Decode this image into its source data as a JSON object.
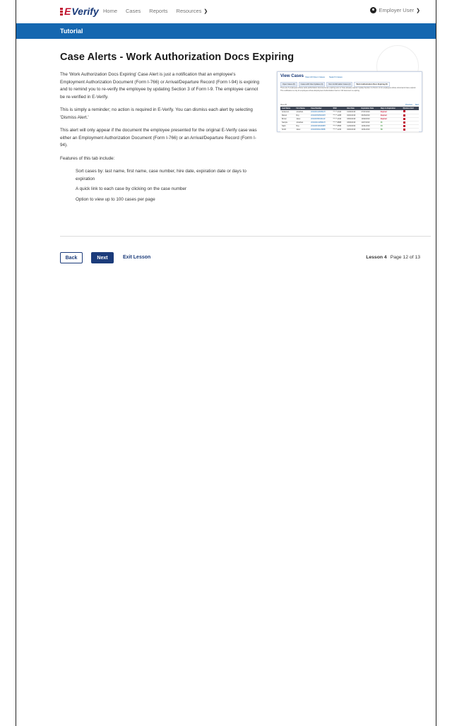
{
  "logo": {
    "text": "Verify",
    "prefix": "E"
  },
  "nav": {
    "items": [
      "Home",
      "Cases",
      "Reports",
      "Resources"
    ],
    "user": "Employer User"
  },
  "banner": {
    "title": "Tutorial"
  },
  "page": {
    "heading": "Case Alerts - Work Authorization Docs Expiring",
    "paragraphs": [
      "The 'Work Authorization Docs Expiring' Case Alert is just a notification that an employee's Employment Authorization Document (Form I-766) or Arrival/Departure Record (Form I-94) is expiring and to remind you to re-verify the employee by updating Section 3 of Form I-9. The employee cannot be re-verified in E-Verify.",
      "This is simply a reminder; no action is required in E-Verify. You can dismiss each alert by selecting 'Dismiss Alert.'",
      "This alert will only appear if the document the employee presented for the original E-Verify case was either an Employment Authorization Document (Form I-766) or an Arrival/Departure Record (Form I-94).",
      "Features of this tab include:"
    ],
    "features": [
      "Sort cases by: last name, first name, case number, hire date, expiration date or days to expiration",
      "A quick link to each case by clicking on the case number",
      "Option to view up to 100 cases per page"
    ]
  },
  "screenshot": {
    "title": "View Cases",
    "menu": [
      "View All Open Cases",
      "Search Cases"
    ],
    "tabs": [
      "Open Cases (8)",
      "Cases with New Updates (3)",
      "Non-Confirmation Cases (2)",
      "Work Authorization Docs Expiring (6)"
    ],
    "desc": "There are 6 employees whose work authorization documents are expiring soon or have already expired. Update Section 3 of Form I-9 for employees whose documents have expired. This notification is only for employees whose Employment Authorization Card or I-94 document is expiring.",
    "controls": {
      "left": "View 25",
      "pager": [
        "Previous",
        "Next"
      ]
    },
    "columns": [
      "Last Name",
      "First Name",
      "Case Number",
      "SSN",
      "Hire Date",
      "Expiration Date",
      "Days to Expiration",
      "Dismiss Alert"
    ],
    "rows": [
      [
        "Anderson",
        "Jonathan",
        "2019234118450AH",
        "***-**-4444",
        "01/02/2019",
        "07/07/2019",
        "Expired",
        "x"
      ],
      [
        "Marcel",
        "Roy",
        "2019233545810DH",
        "***-**-1288",
        "02/01/2019",
        "09/15/2019",
        "Expired",
        "x"
      ],
      [
        "Brown",
        "Janet",
        "2019234500441AZ",
        "***-**-1010",
        "03/01/2019",
        "10/02/2019",
        "Expired",
        "x"
      ],
      [
        "Sample",
        "Jonathan",
        "2019221122890AH",
        "***-**-8888",
        "03/04/2019",
        "11/07/2019",
        "21",
        "x"
      ],
      [
        "Nash",
        "Roy",
        "2019231548430BH",
        "***-**-5555",
        "11/02/2019",
        "12/01/2019",
        "44",
        "x"
      ],
      [
        "Smith",
        "Janet",
        "2019233811230BB",
        "***-**-1234",
        "02/01/2019",
        "12/31/2019",
        "59",
        "x"
      ]
    ]
  },
  "footer": {
    "back": "Back",
    "next": "Next",
    "exit": "Exit Lesson",
    "lesson": "Lesson 4",
    "page": "Page 12 of 13"
  }
}
